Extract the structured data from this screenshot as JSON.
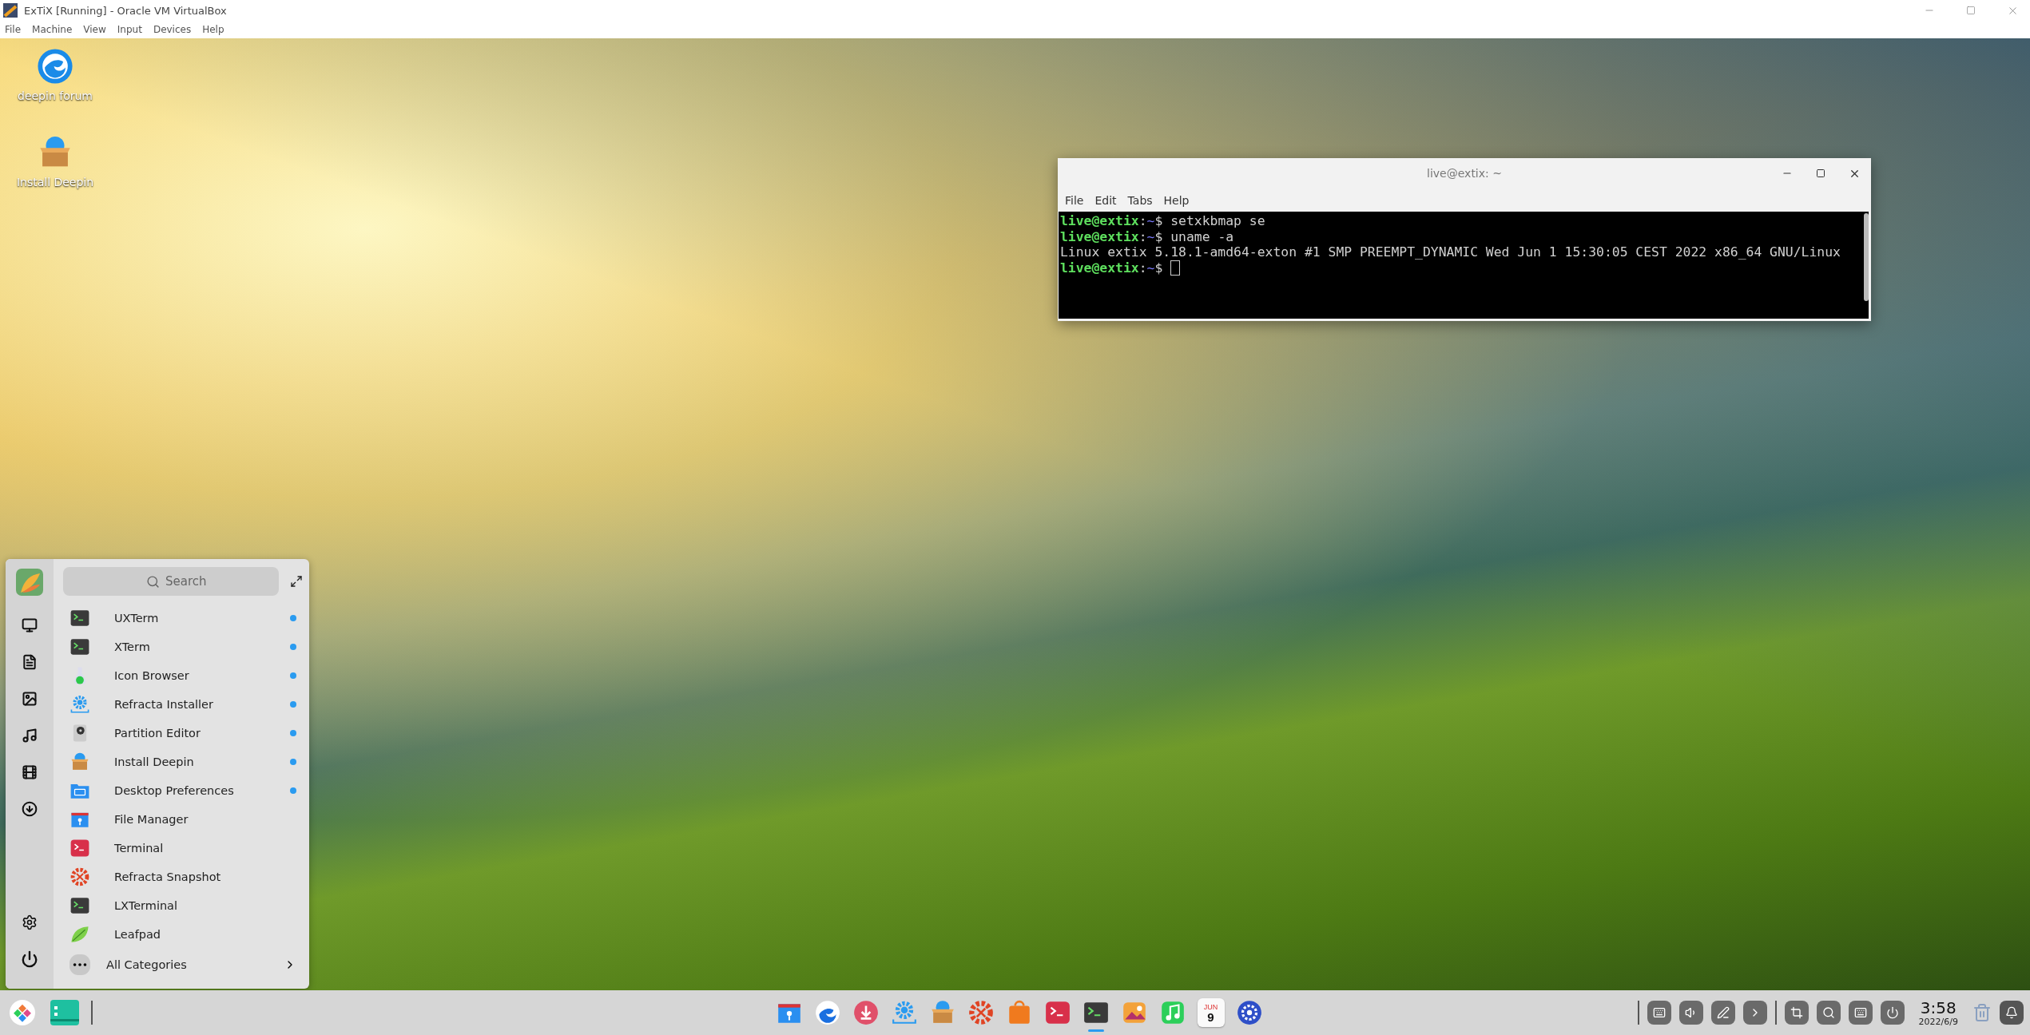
{
  "window": {
    "title": "ExTiX [Running] - Oracle VM VirtualBox"
  },
  "menu": [
    "File",
    "Machine",
    "View",
    "Input",
    "Devices",
    "Help"
  ],
  "desktop_icons": [
    {
      "label": "deepin forum",
      "kind": "deepin"
    },
    {
      "label": "Install Deepin",
      "kind": "package"
    }
  ],
  "terminal": {
    "title": "live@extix: ~",
    "menu": [
      "File",
      "Edit",
      "Tabs",
      "Help"
    ],
    "lines": [
      {
        "kind": "prompt",
        "user": "live@extix",
        "sep": ":",
        "path": "~",
        "sign": "$",
        "command": "setxkbmap se"
      },
      {
        "kind": "prompt",
        "user": "live@extix",
        "sep": ":",
        "path": "~",
        "sign": "$",
        "command": "uname -a"
      },
      {
        "kind": "output",
        "text": "Linux extix 5.18.1-amd64-exton #1 SMP PREEMPT_DYNAMIC Wed Jun 1 15:30:05 CEST 2022 x86_64 GNU/Linux"
      },
      {
        "kind": "prompt",
        "user": "live@extix",
        "sep": ":",
        "path": "~",
        "sign": "$",
        "cursor": true
      }
    ]
  },
  "launcher": {
    "search": {
      "placeholder": "Search"
    },
    "apps": [
      {
        "name": "UXTerm",
        "kind": "term-dark",
        "new": true
      },
      {
        "name": "XTerm",
        "kind": "term-dark",
        "new": true
      },
      {
        "name": "Icon Browser",
        "kind": "flask",
        "new": true
      },
      {
        "name": "Refracta Installer",
        "kind": "installer",
        "new": true
      },
      {
        "name": "Partition Editor",
        "kind": "disk",
        "new": true
      },
      {
        "name": "Install Deepin",
        "kind": "package",
        "new": true
      },
      {
        "name": "Desktop Preferences",
        "kind": "prefs",
        "new": true
      },
      {
        "name": "File Manager",
        "kind": "files",
        "new": false
      },
      {
        "name": "Terminal",
        "kind": "term-red",
        "new": false
      },
      {
        "name": "Refracta Snapshot",
        "kind": "snapshot",
        "new": false
      },
      {
        "name": "LXTerminal",
        "kind": "term-dark",
        "new": false
      },
      {
        "name": "Leafpad",
        "kind": "leaf",
        "new": false
      }
    ],
    "all_categories": {
      "label": "All Categories"
    }
  },
  "dock": [
    {
      "kind": "files",
      "running": false
    },
    {
      "kind": "browser",
      "running": false
    },
    {
      "kind": "download",
      "running": false
    },
    {
      "kind": "installer",
      "running": false
    },
    {
      "kind": "package",
      "running": false
    },
    {
      "kind": "snapshot",
      "running": false
    },
    {
      "kind": "store",
      "running": false
    },
    {
      "kind": "term-red",
      "running": false
    },
    {
      "kind": "term-dark",
      "running": true
    },
    {
      "kind": "photos",
      "running": false
    },
    {
      "kind": "music",
      "running": false
    },
    {
      "kind": "calendar",
      "running": false,
      "month": "JUN",
      "day": "9"
    },
    {
      "kind": "settings",
      "running": false
    }
  ],
  "clock": {
    "time": "3:58",
    "date": "2022/6/9"
  }
}
